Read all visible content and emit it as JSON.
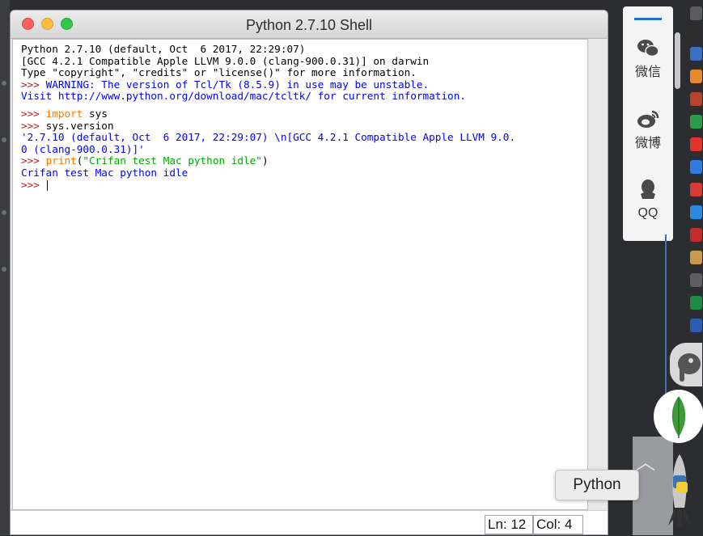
{
  "window": {
    "title": "Python 2.7.10 Shell"
  },
  "shell_lines": [
    {
      "segments": [
        {
          "text": "Python 2.7.10 (default, Oct  6 2017, 22:29:07)",
          "style": "plain"
        }
      ]
    },
    {
      "segments": [
        {
          "text": "[GCC 4.2.1 Compatible Apple LLVM 9.0.0 (clang-900.0.31)] on darwin",
          "style": "plain"
        }
      ]
    },
    {
      "segments": [
        {
          "text": "Type \"copyright\", \"credits\" or \"license()\" for more information.",
          "style": "plain"
        }
      ]
    },
    {
      "segments": [
        {
          "text": ">>> ",
          "style": "prompt"
        },
        {
          "text": "WARNING: The version of Tcl/Tk (8.5.9) in use may be unstable.",
          "style": "err"
        }
      ]
    },
    {
      "segments": [
        {
          "text": "Visit http://www.python.org/download/mac/tcltk/ for current information.",
          "style": "err"
        }
      ]
    },
    {
      "blank": true
    },
    {
      "segments": [
        {
          "text": ">>> ",
          "style": "prompt"
        },
        {
          "text": "import",
          "style": "kw"
        },
        {
          "text": " sys",
          "style": "plain"
        }
      ]
    },
    {
      "segments": [
        {
          "text": ">>> ",
          "style": "prompt"
        },
        {
          "text": "sys.version",
          "style": "plain"
        }
      ]
    },
    {
      "segments": [
        {
          "text": "'2.7.10 (default, Oct  6 2017, 22:29:07) \\n[GCC 4.2.1 Compatible Apple LLVM 9.0.",
          "style": "out"
        }
      ]
    },
    {
      "segments": [
        {
          "text": "0 (clang-900.0.31)]'",
          "style": "out"
        }
      ]
    },
    {
      "segments": [
        {
          "text": ">>> ",
          "style": "prompt"
        },
        {
          "text": "print",
          "style": "kw"
        },
        {
          "text": "(",
          "style": "plain"
        },
        {
          "text": "\"Crifan test Mac python idle\"",
          "style": "str"
        },
        {
          "text": ")",
          "style": "plain"
        }
      ]
    },
    {
      "segments": [
        {
          "text": "Crifan test Mac python idle",
          "style": "out"
        }
      ]
    },
    {
      "segments": [
        {
          "text": ">>> ",
          "style": "prompt"
        }
      ],
      "cursor": true
    }
  ],
  "status": {
    "line": "Ln: 12",
    "column": "Col: 4"
  },
  "sidebar_app": {
    "items": [
      {
        "label": "微信",
        "icon": "wechat-icon"
      },
      {
        "label": "微博",
        "icon": "weibo-icon"
      },
      {
        "label": "QQ",
        "icon": "qq-icon"
      }
    ]
  },
  "tooltip": {
    "text": "Python"
  },
  "colors": {
    "prompt": "#b2191d",
    "keyword": "#ff7700",
    "string": "#00aa00",
    "output": "#0000ff",
    "accent": "#1f73d8"
  }
}
